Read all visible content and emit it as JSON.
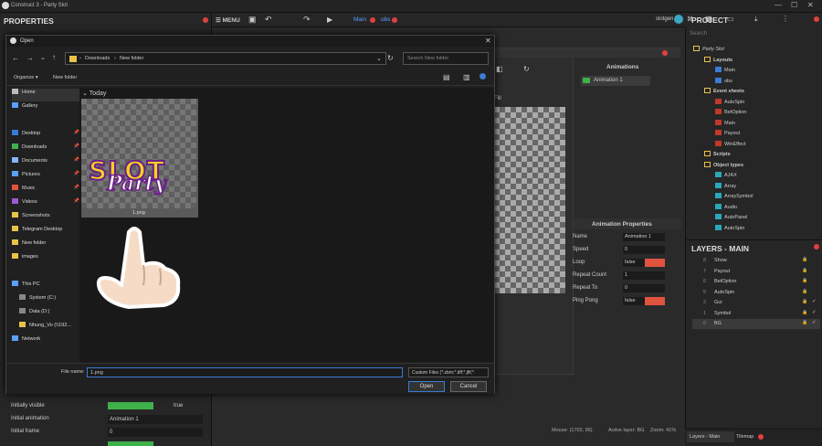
{
  "window": {
    "title": "Construct 3 - Party Slot"
  },
  "left_panel": {
    "title": "PROPERTIES",
    "rows": [
      {
        "label": "Initially visible",
        "value": "true"
      },
      {
        "label": "Initial animation",
        "value": "Animation 1"
      },
      {
        "label": "Initial frame",
        "value": "0"
      }
    ]
  },
  "toolbar": {
    "menu": "MENU",
    "tabs": [
      "Main",
      "obs"
    ],
    "user": "slotgen"
  },
  "dialog": {
    "title": "Open",
    "path": [
      "Downloads",
      "New folder"
    ],
    "search_placeholder": "Search New folder",
    "organize": "Organize",
    "new_folder": "New folder",
    "group": "Today",
    "file": {
      "name": "1.png",
      "art_line1": "SLOT",
      "art_line2": "Party"
    },
    "sidebar": [
      "Home",
      "Gallery",
      "Desktop",
      "Downloads",
      "Documents",
      "Pictures",
      "Music",
      "Videos",
      "Screenshots",
      "Telegram Desktop",
      "New folder",
      "images",
      "This PC",
      "System (C:)",
      "Data (D:)",
      "Nhung_Vo (\\\\192...",
      "Network"
    ],
    "filename_label": "File name:",
    "filename_value": "1.png",
    "filetype": "Custom Files (*.sbm;*.tiff;*.jfif;*.",
    "open": "Open",
    "cancel": "Cancel"
  },
  "animations": {
    "title": "Animations",
    "item": "Animation 1",
    "fill_label": "Fill",
    "props_title": "Animation Properties",
    "props": [
      {
        "label": "Name",
        "value": "Animation 1",
        "flag": false
      },
      {
        "label": "Speed",
        "value": "0",
        "flag": false
      },
      {
        "label": "Loop",
        "value": "false",
        "flag": true
      },
      {
        "label": "Repeat Count",
        "value": "1",
        "flag": false
      },
      {
        "label": "Repeat To",
        "value": "0",
        "flag": false
      },
      {
        "label": "Ping Pong",
        "value": "false",
        "flag": true
      }
    ]
  },
  "project": {
    "title": "PROJECT",
    "search_placeholder": "Search",
    "tree": [
      {
        "label": "Party Slot",
        "level": 0,
        "type": "folder"
      },
      {
        "label": "Layouts",
        "level": 1,
        "type": "folder"
      },
      {
        "label": "Main",
        "level": 2,
        "type": "layout"
      },
      {
        "label": "obs",
        "level": 2,
        "type": "layout"
      },
      {
        "label": "Event sheets",
        "level": 1,
        "type": "folder"
      },
      {
        "label": "AutoSpin",
        "level": 2,
        "type": "event"
      },
      {
        "label": "BetOption",
        "level": 2,
        "type": "event"
      },
      {
        "label": "Main",
        "level": 2,
        "type": "event"
      },
      {
        "label": "Payout",
        "level": 2,
        "type": "event"
      },
      {
        "label": "WinEffect",
        "level": 2,
        "type": "event"
      },
      {
        "label": "Scripts",
        "level": 1,
        "type": "folder"
      },
      {
        "label": "Object types",
        "level": 1,
        "type": "folder"
      },
      {
        "label": "AJAX",
        "level": 2,
        "type": "obj"
      },
      {
        "label": "Array",
        "level": 2,
        "type": "obj"
      },
      {
        "label": "ArraySymbol",
        "level": 2,
        "type": "obj"
      },
      {
        "label": "Audio",
        "level": 2,
        "type": "obj"
      },
      {
        "label": "AutoPanel",
        "level": 2,
        "type": "obj"
      },
      {
        "label": "AutoSpin",
        "level": 2,
        "type": "obj"
      }
    ]
  },
  "layers": {
    "title": "LAYERS - MAIN",
    "rows": [
      {
        "n": "8",
        "label": "Show"
      },
      {
        "n": "7",
        "label": "Payout"
      },
      {
        "n": "6",
        "label": "BetOption"
      },
      {
        "n": "5",
        "label": "AutoSpin"
      },
      {
        "n": "2",
        "label": "Gui"
      },
      {
        "n": "1",
        "label": "Symbol"
      },
      {
        "n": "0",
        "label": "BG"
      }
    ]
  },
  "statusbar": {
    "mouse": "Mouse: (1702, 96)",
    "layer": "Active layer: BG",
    "zoom": "Zoom: 41%"
  },
  "bottom_tabs": [
    "Layers - Main",
    "Tilemap"
  ],
  "colors": {
    "accent": "#5aa0ff",
    "danger": "#e04040",
    "folder": "#e8c34a"
  }
}
